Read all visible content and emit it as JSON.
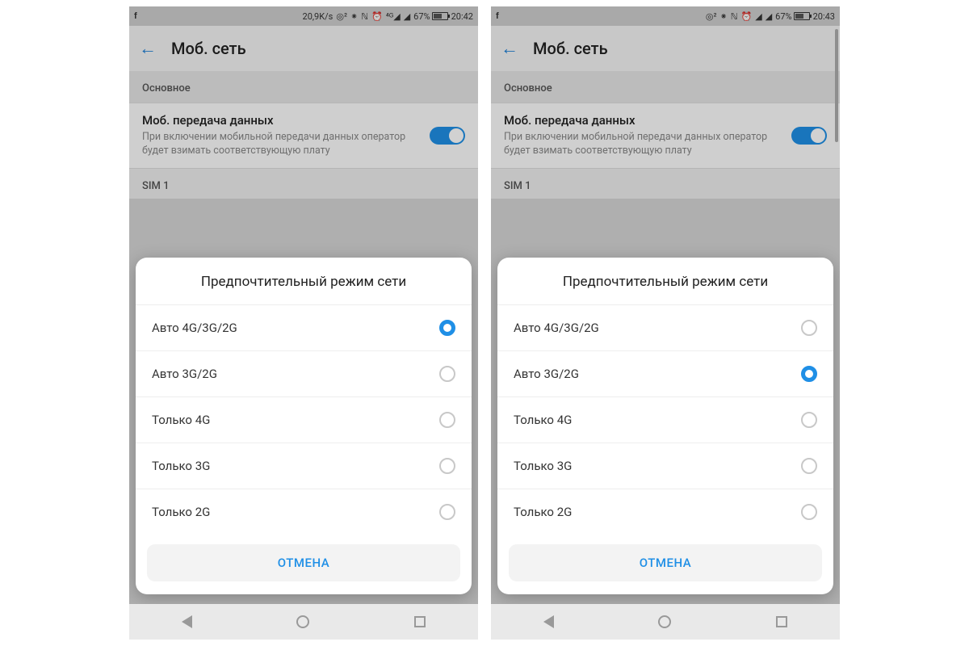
{
  "screens": [
    {
      "statusbar": {
        "left_icon": "f",
        "speed": "20,9K/s",
        "battery_pct": "67%",
        "time": "20:42",
        "show_speed": true
      },
      "header": {
        "title": "Моб. сеть"
      },
      "section_main": "Основное",
      "mobile_data": {
        "title": "Моб. передача данных",
        "subtitle": "При включении мобильной передачи данных оператор будет взимать соответствующую плату"
      },
      "sim_label": "SIM 1",
      "dialog": {
        "title": "Предпочтительный режим сети",
        "options": [
          {
            "label": "Авто 4G/3G/2G",
            "selected": true
          },
          {
            "label": "Авто 3G/2G",
            "selected": false
          },
          {
            "label": "Только 4G",
            "selected": false
          },
          {
            "label": "Только 3G",
            "selected": false
          },
          {
            "label": "Только 2G",
            "selected": false
          }
        ],
        "cancel": "ОТМЕНА"
      },
      "show_scroll": false
    },
    {
      "statusbar": {
        "left_icon": "f",
        "speed": "",
        "battery_pct": "67%",
        "time": "20:43",
        "show_speed": false
      },
      "header": {
        "title": "Моб. сеть"
      },
      "section_main": "Основное",
      "mobile_data": {
        "title": "Моб. передача данных",
        "subtitle": "При включении мобильной передачи данных оператор будет взимать соответствующую плату"
      },
      "sim_label": "SIM 1",
      "dialog": {
        "title": "Предпочтительный режим сети",
        "options": [
          {
            "label": "Авто 4G/3G/2G",
            "selected": false
          },
          {
            "label": "Авто 3G/2G",
            "selected": true
          },
          {
            "label": "Только 4G",
            "selected": false
          },
          {
            "label": "Только 3G",
            "selected": false
          },
          {
            "label": "Только 2G",
            "selected": false
          }
        ],
        "cancel": "ОТМЕНА"
      },
      "show_scroll": true
    }
  ],
  "status_icons": "⦿ ✱ ℕ ⏰ ▮◢ ▮◢"
}
